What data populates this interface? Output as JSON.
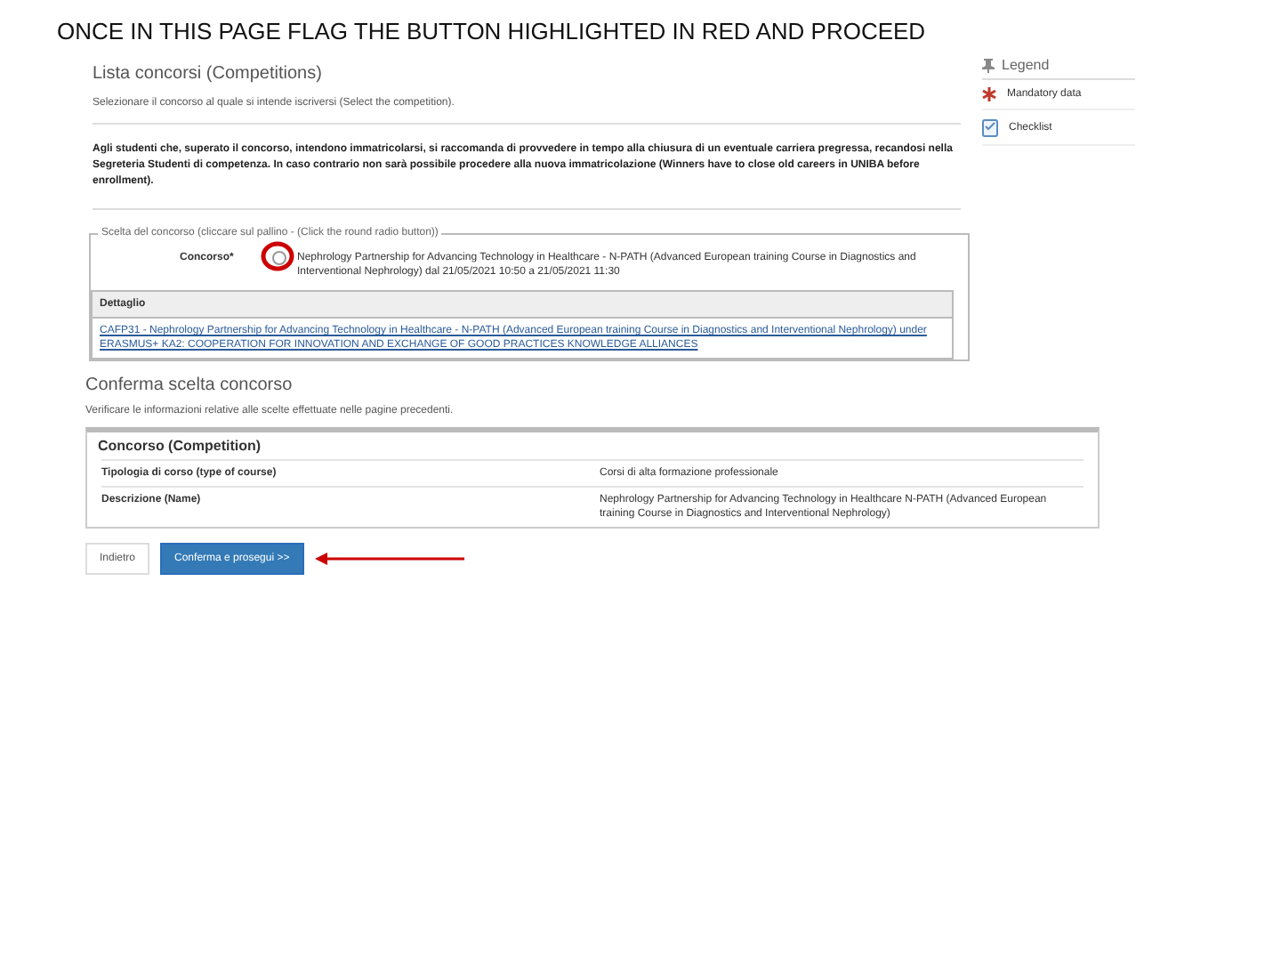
{
  "instruction": "ONCE IN THIS PAGE FLAG THE BUTTON HIGHLIGHTED IN RED AND PROCEED",
  "list_page": {
    "title": "Lista concorsi (Competitions)",
    "subtitle": "Selezionare il concorso al quale si intende iscriversi (Select the competition).",
    "notice": "Agli studenti che, superato il concorso, intendono immatricolarsi, si raccomanda di provvedere in tempo alla chiusura di un eventuale carriera pregressa, recandosi nella Segreteria Studenti di competenza. In caso contrario non sarà possibile procedere alla nuova immatricolazione (Winners have to close old careers in UNIBA before enrollment).",
    "selection": {
      "legend": "Scelta del concorso (cliccare sul pallino - (Click the round radio button))",
      "field_label": "Concorso*",
      "option": {
        "selected": false,
        "text": "Nephrology Partnership for Advancing Technology in Healthcare - N-PATH (Advanced European training Course in Diagnostics and Interventional Nephrology) dal 21/05/2021 10:50 a 21/05/2021 11:30"
      },
      "detail_heading": "Dettaglio",
      "detail_link": "CAFP31 - Nephrology Partnership for Advancing Technology in Healthcare - N-PATH (Advanced European training Course in Diagnostics and Interventional Nephrology) under ERASMUS+ KA2: COOPERATION FOR INNOVATION AND EXCHANGE OF GOOD PRACTICES KNOWLEDGE ALLIANCES"
    }
  },
  "legend": {
    "title": "Legend",
    "items": [
      {
        "kind": "mandatory",
        "label": "Mandatory data"
      },
      {
        "kind": "checklist",
        "label": "Checklist"
      }
    ]
  },
  "confirm_page": {
    "title": "Conferma scelta concorso",
    "subtitle": "Verificare le informazioni relative alle scelte effettuate nelle pagine precedenti.",
    "section": "Concorso (Competition)",
    "rows": [
      {
        "label": "Tipologia di corso (type of course)",
        "value": "Corsi di alta formazione professionale"
      },
      {
        "label": "Descrizione (Name)",
        "value": "Nephrology Partnership for Advancing Technology in Healthcare  N-PATH (Advanced European training Course in Diagnostics and Interventional Nephrology)"
      }
    ],
    "buttons": [
      {
        "kind": "plain",
        "label": "Indietro"
      },
      {
        "kind": "primary",
        "label": "Conferma e prosegui >>"
      }
    ]
  }
}
